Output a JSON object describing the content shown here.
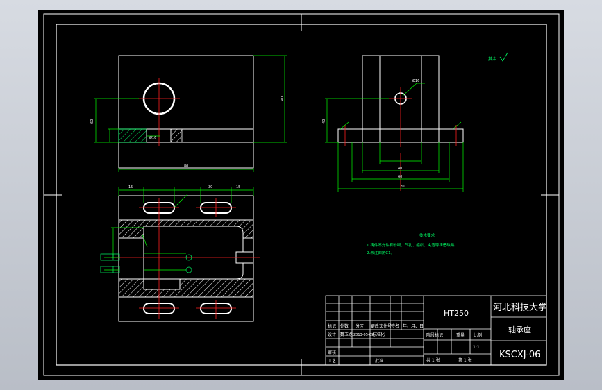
{
  "drawing": {
    "background": "#000000",
    "line_color": "#ffffff",
    "dim_color": "#00ff00",
    "center_color": "#ff2020",
    "roughness_label": "其余",
    "dims": {
      "top_width": "80",
      "top_height": "60",
      "right_height": "40",
      "hole_mark": "Ø16",
      "bottom_total": "120",
      "bottom_mid": "60",
      "bottom_inner": "40",
      "plan_left": "15",
      "plan_mid": "30",
      "plan_right": "15"
    },
    "notes": {
      "title": "技术要求",
      "line1": "1.铸件不允许有砂眼、气孔、缩松、夹渣等铸造缺陷。",
      "line2": "2.未注倒角C1。"
    }
  },
  "title_block": {
    "material": "HT250",
    "university": "河北科技大学",
    "part_name": "轴承座",
    "drawing_no": "KSCXJ-06",
    "scale": "1:1",
    "row_labels": {
      "mark": "标记",
      "count": "处数",
      "zone": "分区",
      "change_doc": "更改文件号",
      "signature": "签名",
      "date": "年、月、日",
      "design": "设计",
      "designer": "魏玉龙",
      "design_date": "2013-05-09",
      "standard": "标准化",
      "review": "审核",
      "process": "工艺",
      "approve": "批准",
      "stage_mark": "阶段标记",
      "weight": "重量",
      "ratio": "比例",
      "sheets": "共 1 张",
      "sheet_no": "第 1 张"
    }
  }
}
